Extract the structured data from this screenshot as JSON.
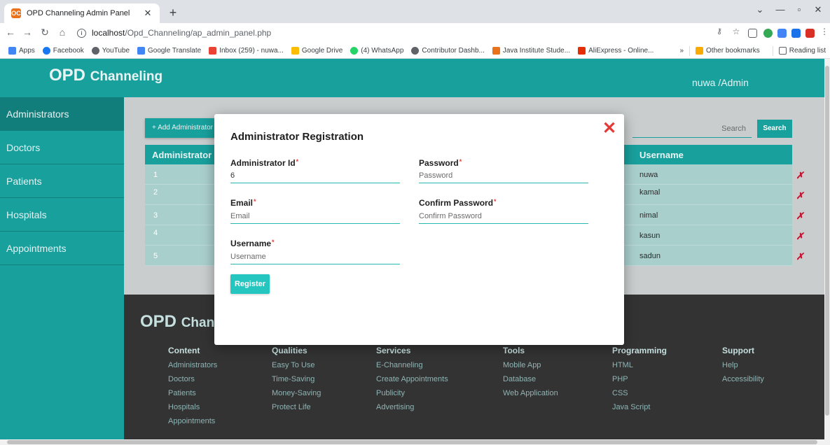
{
  "browser": {
    "tab_title": "OPD Channeling Admin Panel",
    "tab_close": "✕",
    "new_tab": "+",
    "favicon_text": "OC",
    "url_host": "localhost",
    "url_path": "/Opd_Channeling/ap_admin_panel.php",
    "bookmarks": [
      {
        "label": "Apps",
        "icon_color": "#4285f4"
      },
      {
        "label": "Facebook",
        "icon_color": "#1877f2"
      },
      {
        "label": "YouTube",
        "icon_color": "#5f6368"
      },
      {
        "label": "Google Translate",
        "icon_color": "#4285f4"
      },
      {
        "label": "Inbox (259) - nuwa...",
        "icon_color": "#ea4335"
      },
      {
        "label": "Google Drive",
        "icon_color": "#fbbc04"
      },
      {
        "label": "(4) WhatsApp",
        "icon_color": "#25d366"
      },
      {
        "label": "Contributor Dashb...",
        "icon_color": "#5f6368"
      },
      {
        "label": "Java Institute Stude...",
        "icon_color": "#e8731c"
      },
      {
        "label": "AliExpress - Online...",
        "icon_color": "#e62e04"
      }
    ],
    "bookmarks_overflow": "»",
    "other_bookmarks": "Other bookmarks",
    "reading_list": "Reading list"
  },
  "header": {
    "brand_big": "OPD",
    "brand_small": "Channeling",
    "user": "nuwa /Admin"
  },
  "sidebar": {
    "items": [
      {
        "label": "Administrators"
      },
      {
        "label": "Doctors"
      },
      {
        "label": "Patients"
      },
      {
        "label": "Hospitals"
      },
      {
        "label": "Appointments"
      }
    ]
  },
  "content": {
    "add_button": "+ Add Administrator",
    "search_placeholder": "Search",
    "search_button": "Search",
    "table": {
      "col_id": "Administrator Id",
      "col_username": "Username",
      "rows": [
        {
          "id": "1",
          "username": "nuwa"
        },
        {
          "id": "2",
          "username": "kamal"
        },
        {
          "id": "3",
          "username": "nimal"
        },
        {
          "id": "4",
          "username": "kasun"
        },
        {
          "id": "5",
          "username": "sadun"
        }
      ],
      "delete_glyph": "✗"
    }
  },
  "footer": {
    "brand_big": "OPD",
    "brand_small": "Channeling",
    "columns": [
      {
        "heading": "Content",
        "items": [
          "Administrators",
          "Doctors",
          "Patients",
          "Hospitals",
          "Appointments"
        ]
      },
      {
        "heading": "Qualities",
        "items": [
          "Easy To Use",
          "Time-Saving",
          "Money-Saving",
          "Protect Life"
        ]
      },
      {
        "heading": "Services",
        "items": [
          "E-Channeling",
          "Create Appointments",
          "Publicity",
          "Advertising"
        ]
      },
      {
        "heading": "Tools",
        "items": [
          "Mobile App",
          "Database",
          "Web Application"
        ]
      },
      {
        "heading": "Programming",
        "items": [
          "HTML",
          "PHP",
          "CSS",
          "Java Script"
        ]
      },
      {
        "heading": "Support",
        "items": [
          "Help",
          "Accessibility"
        ]
      }
    ]
  },
  "modal": {
    "title": "Administrator Registration",
    "close_glyph": "✕",
    "required_mark": "*",
    "fields": {
      "admin_id": {
        "label": "Administrator Id",
        "value": "6",
        "placeholder": ""
      },
      "password": {
        "label": "Password",
        "value": "",
        "placeholder": "Password"
      },
      "email": {
        "label": "Email",
        "value": "",
        "placeholder": "Email"
      },
      "confirm_password": {
        "label": "Confirm Password",
        "value": "",
        "placeholder": "Confirm Password"
      },
      "username": {
        "label": "Username",
        "value": "",
        "placeholder": "Username"
      }
    },
    "register_button": "Register"
  },
  "colors": {
    "brand_teal": "#18a09d",
    "table_row": "#a9cfcd",
    "footer_bg": "#333333",
    "delete_red": "#c8102e",
    "close_red": "#e53935"
  }
}
